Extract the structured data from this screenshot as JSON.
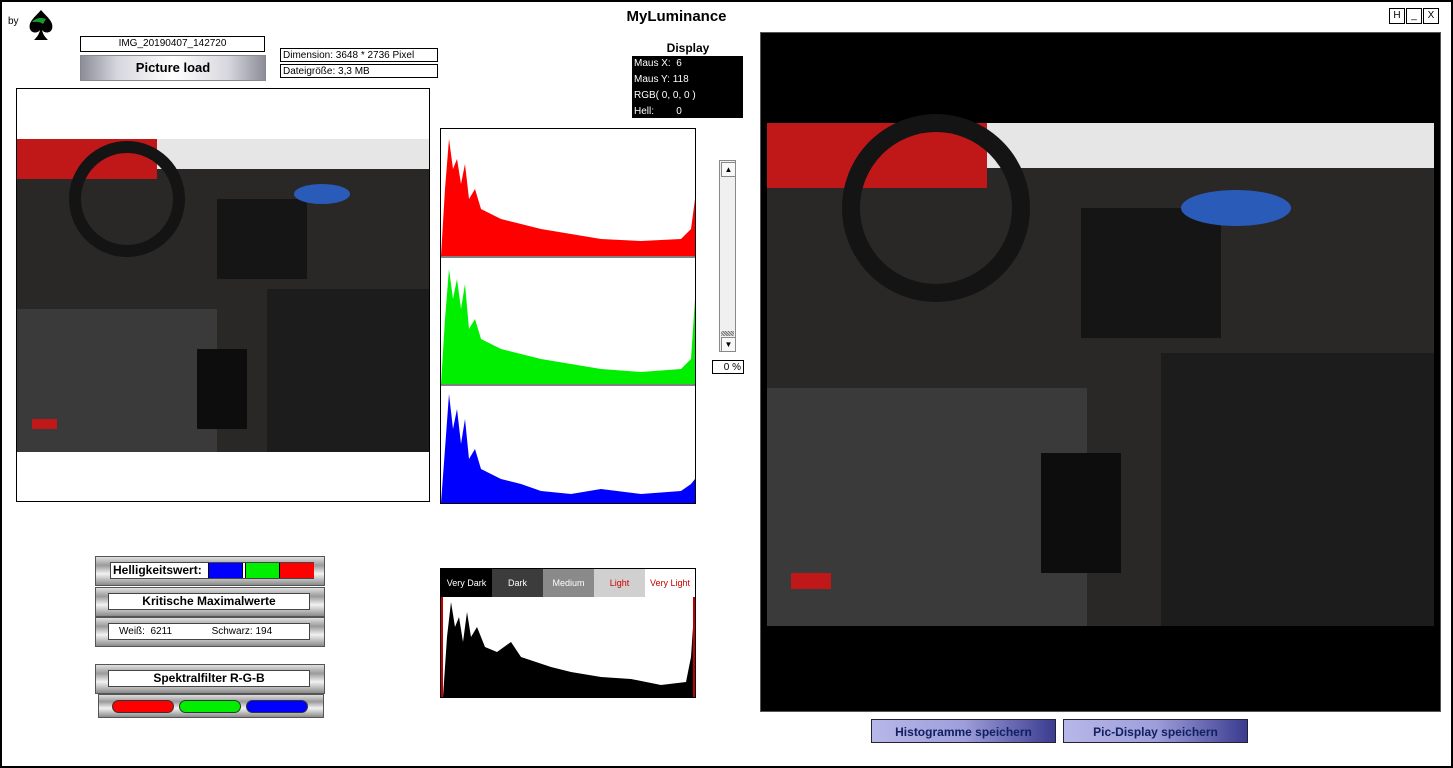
{
  "app": {
    "title": "MyLuminance",
    "by_label": "by"
  },
  "window_buttons": [
    "H",
    "_",
    "X"
  ],
  "file": {
    "name": "IMG_20190407_142720",
    "load_label": "Picture load",
    "dimension": "Dimension: 3648 * 2736 Pixel",
    "filesize": "Dateigröße: 3,3 MB"
  },
  "display": {
    "title": "Display",
    "maus_x_label": "Maus X:",
    "maus_x": "6",
    "maus_y_label": "Maus Y:",
    "maus_y": "118",
    "rgb": "RGB( 0, 0, 0 )",
    "hell_label": "Hell:",
    "hell": "0"
  },
  "slider": {
    "value": "0 %",
    "level": 0
  },
  "panels": {
    "helligkeit": "Helligkeitswert:",
    "kritisch": "Kritische Maximalwerte",
    "weiss_label": "Weiß:",
    "weiss_value": "6211",
    "schwarz_label": "Schwarz:",
    "schwarz_value": "194",
    "spektral": "Spektralfilter R-G-B"
  },
  "luminance_bands": [
    {
      "label": "Very Dark",
      "bg": "#000000",
      "fg": "#ffffff"
    },
    {
      "label": "Dark",
      "bg": "#3c3c3c",
      "fg": "#ffffff"
    },
    {
      "label": "Medium",
      "bg": "#8a8a8a",
      "fg": "#ffffff"
    },
    {
      "label": "Light",
      "bg": "#d0d0d0",
      "fg": "#cc0000"
    },
    {
      "label": "Very Light",
      "bg": "#ffffff",
      "fg": "#cc0000"
    }
  ],
  "save_buttons": {
    "histogramme": "Histogramme speichern",
    "pic_display": "Pic-Display speichern"
  },
  "colors": {
    "red": "#ff0000",
    "green": "#00ee00",
    "blue": "#0000ff",
    "lum": "#000000"
  }
}
